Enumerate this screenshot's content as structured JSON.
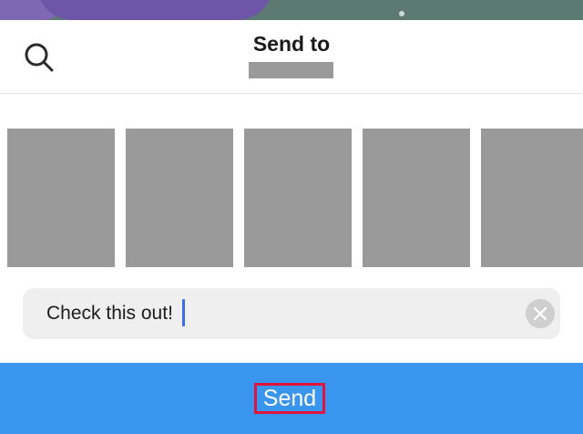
{
  "header": {
    "title": "Send to",
    "search_icon": "search-icon"
  },
  "recipients": [
    {
      "name": ""
    },
    {
      "name": ""
    },
    {
      "name": ""
    },
    {
      "name": ""
    },
    {
      "name": ""
    }
  ],
  "message": {
    "value": "Check this out!",
    "clear_icon": "close-icon"
  },
  "send": {
    "label": "Send"
  },
  "colors": {
    "accent": "#3a95ef",
    "highlight_border": "#e0143c",
    "placeholder_gray": "#9a9a9a"
  }
}
